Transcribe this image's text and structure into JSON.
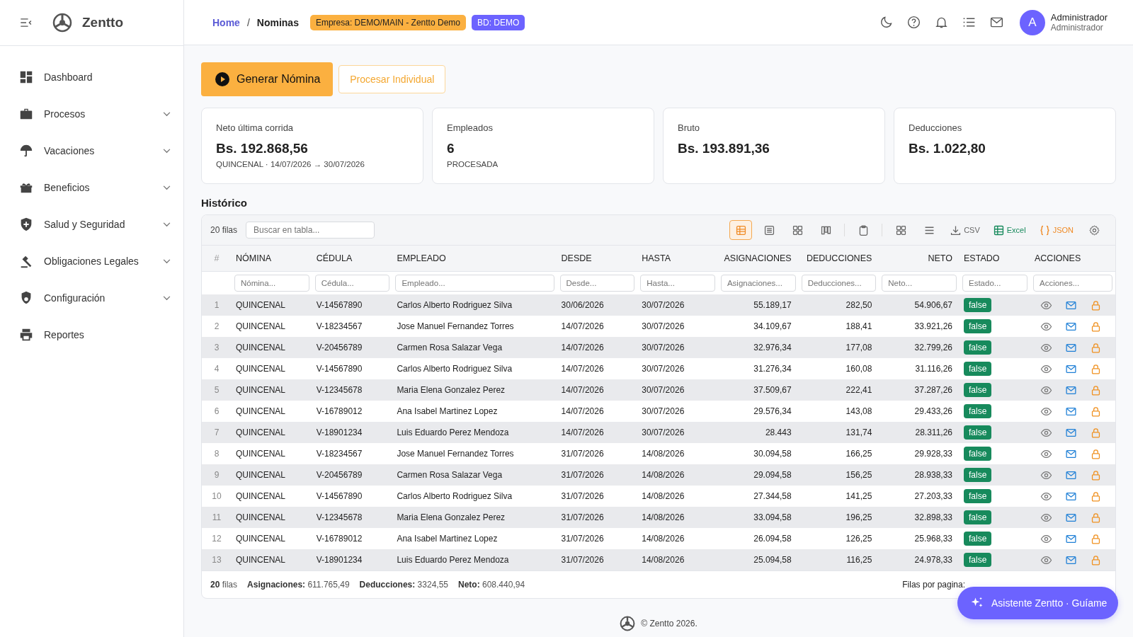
{
  "sidebar": {
    "brand": "Zentto",
    "items": [
      {
        "label": "Dashboard",
        "expandable": false
      },
      {
        "label": "Procesos",
        "expandable": true
      },
      {
        "label": "Vacaciones",
        "expandable": true
      },
      {
        "label": "Beneficios",
        "expandable": true
      },
      {
        "label": "Salud y Seguridad",
        "expandable": true
      },
      {
        "label": "Obligaciones Legales",
        "expandable": true
      },
      {
        "label": "Configuración",
        "expandable": true
      },
      {
        "label": "Reportes",
        "expandable": false
      }
    ]
  },
  "header": {
    "breadcrumb": [
      {
        "label": "Home",
        "link": true
      },
      {
        "label": "Nominas",
        "link": false
      }
    ],
    "breadcrumb_separator": "/",
    "badges": [
      {
        "text": "Empresa: DEMO/MAIN - Zentto Demo",
        "color": "#fbb040"
      },
      {
        "text": "BD: DEMO",
        "color": "#6c63ff"
      }
    ],
    "user": {
      "initial": "A",
      "name": "Administrador",
      "role": "Administrador"
    }
  },
  "actions": [
    {
      "label": "Generar Nómina",
      "kind": "primary"
    },
    {
      "label": "Procesar Individual",
      "kind": "outline"
    }
  ],
  "stats": [
    {
      "label": "Neto última corrida",
      "value": "Bs. 192.868,56",
      "sub": "QUINCENAL · 14/07/2026 → 30/07/2026"
    },
    {
      "label": "Empleados",
      "value": "6",
      "sub": "PROCESADA"
    },
    {
      "label": "Bruto",
      "value": "Bs. 193.891,36"
    },
    {
      "label": "Deducciones",
      "value": "Bs. 1.022,80"
    }
  ],
  "table": {
    "title": "Histórico",
    "count": "20 filas",
    "search_placeholder": "Buscar en tabla...",
    "views": [
      {
        "selected": true
      },
      {
        "selected": false
      },
      {
        "selected": false
      },
      {
        "selected": false
      }
    ],
    "exports": [
      {
        "label": "CSV",
        "kind": "csv"
      },
      {
        "label": "Excel",
        "kind": "excel"
      },
      {
        "label": "JSON",
        "kind": "json"
      }
    ],
    "columns": [
      {
        "label": "#"
      },
      {
        "label": "NÓMINA",
        "placeholder": "Nómina..."
      },
      {
        "label": "CÉDULA",
        "placeholder": "Cédula..."
      },
      {
        "label": "EMPLEADO",
        "placeholder": "Empleado..."
      },
      {
        "label": "DESDE",
        "placeholder": "Desde..."
      },
      {
        "label": "HASTA",
        "placeholder": "Hasta..."
      },
      {
        "label": "ASIGNACIONES",
        "placeholder": "Asignaciones..."
      },
      {
        "label": "DEDUCCIONES",
        "placeholder": "Deducciones..."
      },
      {
        "label": "NETO",
        "placeholder": "Neto..."
      },
      {
        "label": "ESTADO",
        "placeholder": "Estado..."
      },
      {
        "label": "ACCIONES",
        "placeholder": "Acciones..."
      }
    ],
    "rows": [
      {
        "cells": [
          "1",
          "QUINCENAL",
          "V-14567890",
          "Carlos Alberto Rodriguez Silva",
          "30/06/2026",
          "30/07/2026",
          "55.189,17",
          "282,50",
          "54.906,67",
          "false"
        ]
      },
      {
        "cells": [
          "2",
          "QUINCENAL",
          "V-18234567",
          "Jose Manuel Fernandez Torres",
          "14/07/2026",
          "30/07/2026",
          "34.109,67",
          "188,41",
          "33.921,26",
          "false"
        ]
      },
      {
        "cells": [
          "3",
          "QUINCENAL",
          "V-20456789",
          "Carmen Rosa Salazar Vega",
          "14/07/2026",
          "30/07/2026",
          "32.976,34",
          "177,08",
          "32.799,26",
          "false"
        ]
      },
      {
        "cells": [
          "4",
          "QUINCENAL",
          "V-14567890",
          "Carlos Alberto Rodriguez Silva",
          "14/07/2026",
          "30/07/2026",
          "31.276,34",
          "160,08",
          "31.116,26",
          "false"
        ]
      },
      {
        "cells": [
          "5",
          "QUINCENAL",
          "V-12345678",
          "Maria Elena Gonzalez Perez",
          "14/07/2026",
          "30/07/2026",
          "37.509,67",
          "222,41",
          "37.287,26",
          "false"
        ]
      },
      {
        "cells": [
          "6",
          "QUINCENAL",
          "V-16789012",
          "Ana Isabel Martinez Lopez",
          "14/07/2026",
          "30/07/2026",
          "29.576,34",
          "143,08",
          "29.433,26",
          "false"
        ]
      },
      {
        "cells": [
          "7",
          "QUINCENAL",
          "V-18901234",
          "Luis Eduardo Perez Mendoza",
          "14/07/2026",
          "30/07/2026",
          "28.443",
          "131,74",
          "28.311,26",
          "false"
        ]
      },
      {
        "cells": [
          "8",
          "QUINCENAL",
          "V-18234567",
          "Jose Manuel Fernandez Torres",
          "31/07/2026",
          "14/08/2026",
          "30.094,58",
          "166,25",
          "29.928,33",
          "false"
        ]
      },
      {
        "cells": [
          "9",
          "QUINCENAL",
          "V-20456789",
          "Carmen Rosa Salazar Vega",
          "31/07/2026",
          "14/08/2026",
          "29.094,58",
          "156,25",
          "28.938,33",
          "false"
        ]
      },
      {
        "cells": [
          "10",
          "QUINCENAL",
          "V-14567890",
          "Carlos Alberto Rodriguez Silva",
          "31/07/2026",
          "14/08/2026",
          "27.344,58",
          "141,25",
          "27.203,33",
          "false"
        ]
      },
      {
        "cells": [
          "11",
          "QUINCENAL",
          "V-12345678",
          "Maria Elena Gonzalez Perez",
          "31/07/2026",
          "14/08/2026",
          "33.094,58",
          "196,25",
          "32.898,33",
          "false"
        ]
      },
      {
        "cells": [
          "12",
          "QUINCENAL",
          "V-16789012",
          "Ana Isabel Martinez Lopez",
          "31/07/2026",
          "14/08/2026",
          "26.094,58",
          "126,25",
          "25.968,33",
          "false"
        ]
      },
      {
        "cells": [
          "13",
          "QUINCENAL",
          "V-18901234",
          "Luis Eduardo Perez Mendoza",
          "31/07/2026",
          "14/08/2026",
          "25.094,58",
          "116,25",
          "24.978,33",
          "false"
        ]
      }
    ],
    "footer": {
      "count": "20",
      "count_label": "filas",
      "totals": [
        {
          "label": "Asignaciones:",
          "value": "611.765,49"
        },
        {
          "label": "Deducciones:",
          "value": "3324,55"
        },
        {
          "label": "Neto:",
          "value": "608.440,94"
        }
      ],
      "per_page_label": "Filas por pagina:"
    }
  },
  "assistant": "Asistente Zentto · Guíame",
  "copyright": "© Zentto 2026."
}
